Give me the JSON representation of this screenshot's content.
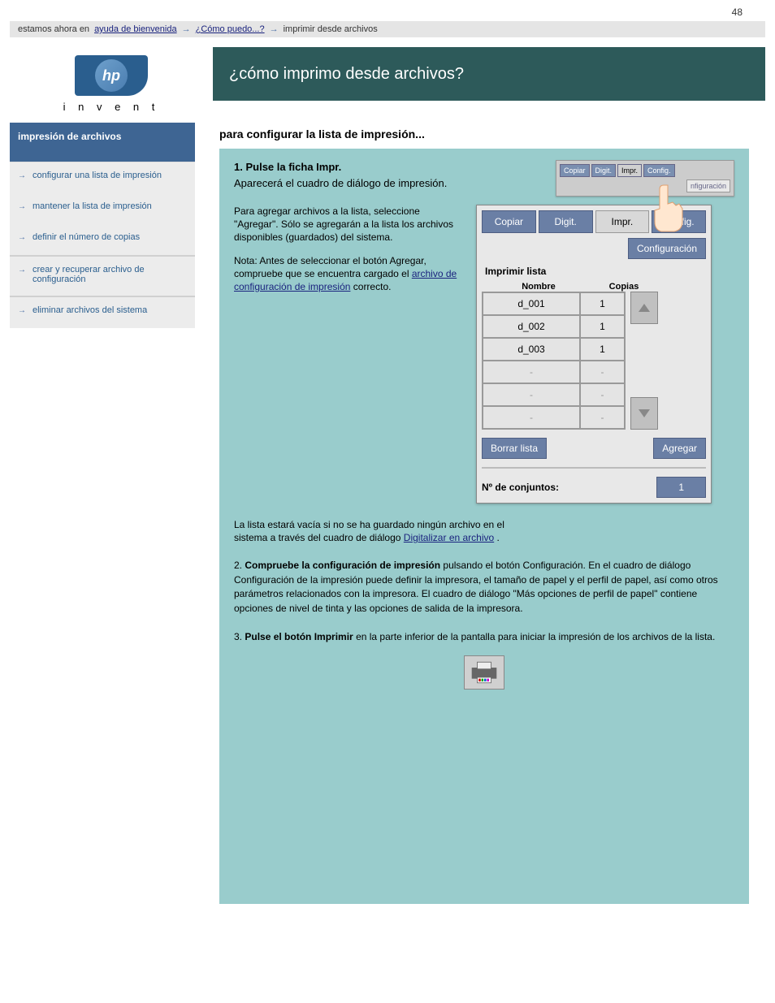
{
  "page_number": "48",
  "breadcrumb": {
    "item1": "estamos ahora en",
    "item2": "ayuda de bienvenida",
    "item3": "¿Cómo puedo...?",
    "item4": "imprimir desde archivos"
  },
  "logo_tagline": "i n v e n t",
  "page_title": "¿cómo imprimo desde archivos?",
  "sidebar": {
    "heading": "impresión de archivos",
    "items": [
      "configurar una lista de impresión",
      "mantener la lista de impresión",
      "definir el número de copias",
      "crear y recuperar archivo de configuración",
      "eliminar archivos del sistema"
    ]
  },
  "intro": "para configurar la lista de impresión...",
  "step": {
    "num": "1.",
    "main": "Pulse la ficha Impr.",
    "sub": "Aparecerá el cuadro de diálogo de impresión."
  },
  "mini_tabs": {
    "copy": "Copiar",
    "scan": "Digit.",
    "print": "Impr.",
    "config": "Config.",
    "conf": "nfiguración"
  },
  "left_text": {
    "p1": "Para agregar archivos a la lista, seleccione \"Agregar\". Sólo se agregarán a la lista los archivos disponibles (guardados) del sistema.",
    "p2_pre": "Nota: Antes de seleccionar el botón Agregar, compruebe que se encuentra cargado el ",
    "p2_link": "archivo de configuración de impresión",
    "p2_post": " correcto."
  },
  "tabs": {
    "copy": "Copiar",
    "scan": "Digit.",
    "print": "Impr.",
    "config": "Config."
  },
  "configuration_btn": "Configuración",
  "list_title": "Imprimir lista",
  "cols": {
    "name": "Nombre",
    "copies": "Copias"
  },
  "rows": [
    {
      "name": "d_001",
      "copies": "1"
    },
    {
      "name": "d_002",
      "copies": "1"
    },
    {
      "name": "d_003",
      "copies": "1"
    },
    {
      "name": "-",
      "copies": "-"
    },
    {
      "name": "-",
      "copies": "-"
    },
    {
      "name": "-",
      "copies": "-"
    }
  ],
  "clear_btn": "Borrar lista",
  "add_btn": "Agregar",
  "sets_label": "Nº de conjuntos:",
  "sets_value": "1",
  "bottom1": {
    "pre": "La lista estará vacía si no se ha guardado ningún archivo en el sistema a través del cuadro de diálogo ",
    "link": "Digitalizar en archivo",
    "post": "."
  },
  "bottom2": {
    "num": "2.",
    "strong": "Compruebe la configuración de impresión",
    "body": " pulsando el botón Configuración. En el cuadro de diálogo Configuración de la impresión puede definir la impresora, el tamaño de papel y el perfil de papel, así como otros parámetros relacionados con la impresora. El cuadro de diálogo \"Más opciones de perfil de papel\" contiene opciones de nivel de tinta y las opciones de salida de la impresora."
  },
  "bottom3": {
    "num": "3.",
    "strong": "Pulse el botón Imprimir",
    "body": " en la parte inferior de la pantalla para iniciar la impresión de los archivos de la lista."
  }
}
